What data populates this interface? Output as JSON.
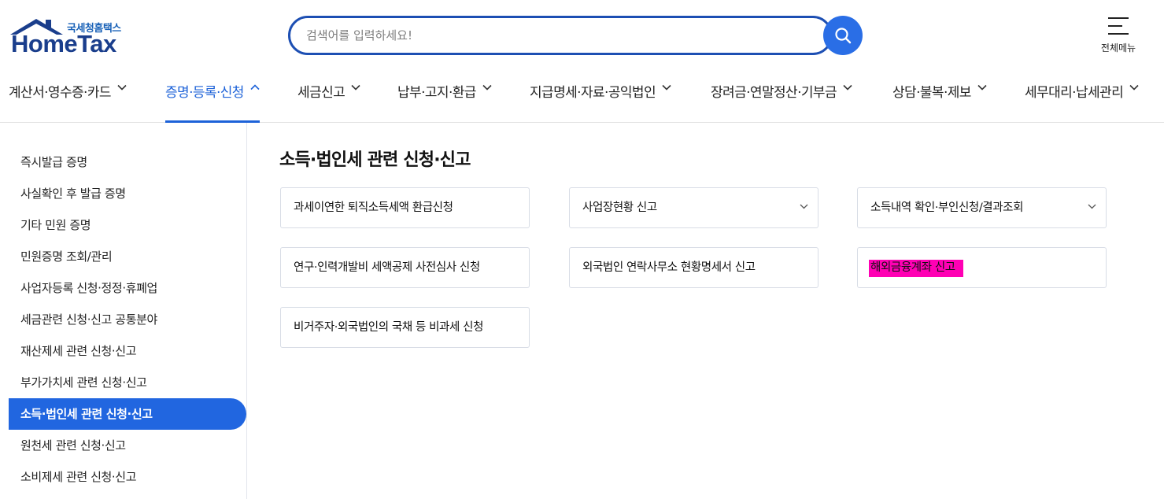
{
  "logo": {
    "sub": "국세청홈택스",
    "main": "HomeTax"
  },
  "search": {
    "placeholder": "검색어를 입력하세요!",
    "value": ""
  },
  "allmenu": {
    "label": "전체메뉴"
  },
  "nav": {
    "items": [
      {
        "label": "계산서·영수증·카드",
        "active": false
      },
      {
        "label": "증명·등록·신청",
        "active": true
      },
      {
        "label": "세금신고",
        "active": false
      },
      {
        "label": "납부·고지·환급",
        "active": false
      },
      {
        "label": "지급명세·자료·공익법인",
        "active": false
      },
      {
        "label": "장려금·연말정산·기부금",
        "active": false
      },
      {
        "label": "상담·불복·제보",
        "active": false
      },
      {
        "label": "세무대리·납세관리",
        "active": false
      }
    ]
  },
  "sidebar": {
    "items": [
      {
        "label": "즉시발급 증명"
      },
      {
        "label": "사실확인 후 발급 증명"
      },
      {
        "label": "기타 민원 증명"
      },
      {
        "label": "민원증명 조회/관리"
      },
      {
        "label": "사업자등록 신청·정정·휴폐업"
      },
      {
        "label": "세금관련 신청·신고 공통분야"
      },
      {
        "label": "재산제세 관련 신청·신고"
      },
      {
        "label": "부가가치세 관련 신청·신고"
      },
      {
        "label": "소득·법인세 관련 신청·신고",
        "active": true
      },
      {
        "label": "원천세 관련 신청·신고"
      },
      {
        "label": "소비제세 관련 신청·신고"
      }
    ]
  },
  "main": {
    "title": "소득·법인세 관련 신청·신고",
    "cards": [
      {
        "label": "과세이연한 퇴직소득세액 환급신청",
        "expandable": false
      },
      {
        "label": "사업장현황 신고",
        "expandable": true
      },
      {
        "label": "소득내역 확인·부인신청/결과조회",
        "expandable": true
      },
      {
        "label": "연구·인력개발비 세액공제 사전심사 신청",
        "expandable": false
      },
      {
        "label": "외국법인 연락사무소 현황명세서 신고",
        "expandable": false
      },
      {
        "label": "해외금융계좌 신고",
        "expandable": false,
        "highlighted": true
      },
      {
        "label": "비거주자·외국법인의 국채 등 비과세 신청",
        "expandable": false
      }
    ]
  },
  "colors": {
    "brand_blue": "#2166e0",
    "nav_active": "#1d62d8",
    "highlight": "#ff00b4",
    "logo_navy": "#1a3e8c"
  },
  "icons": {
    "search": "search-icon",
    "menu": "hamburger-menu-icon",
    "chevron_down": "chevron-down-icon",
    "chevron_up": "chevron-up-icon"
  }
}
